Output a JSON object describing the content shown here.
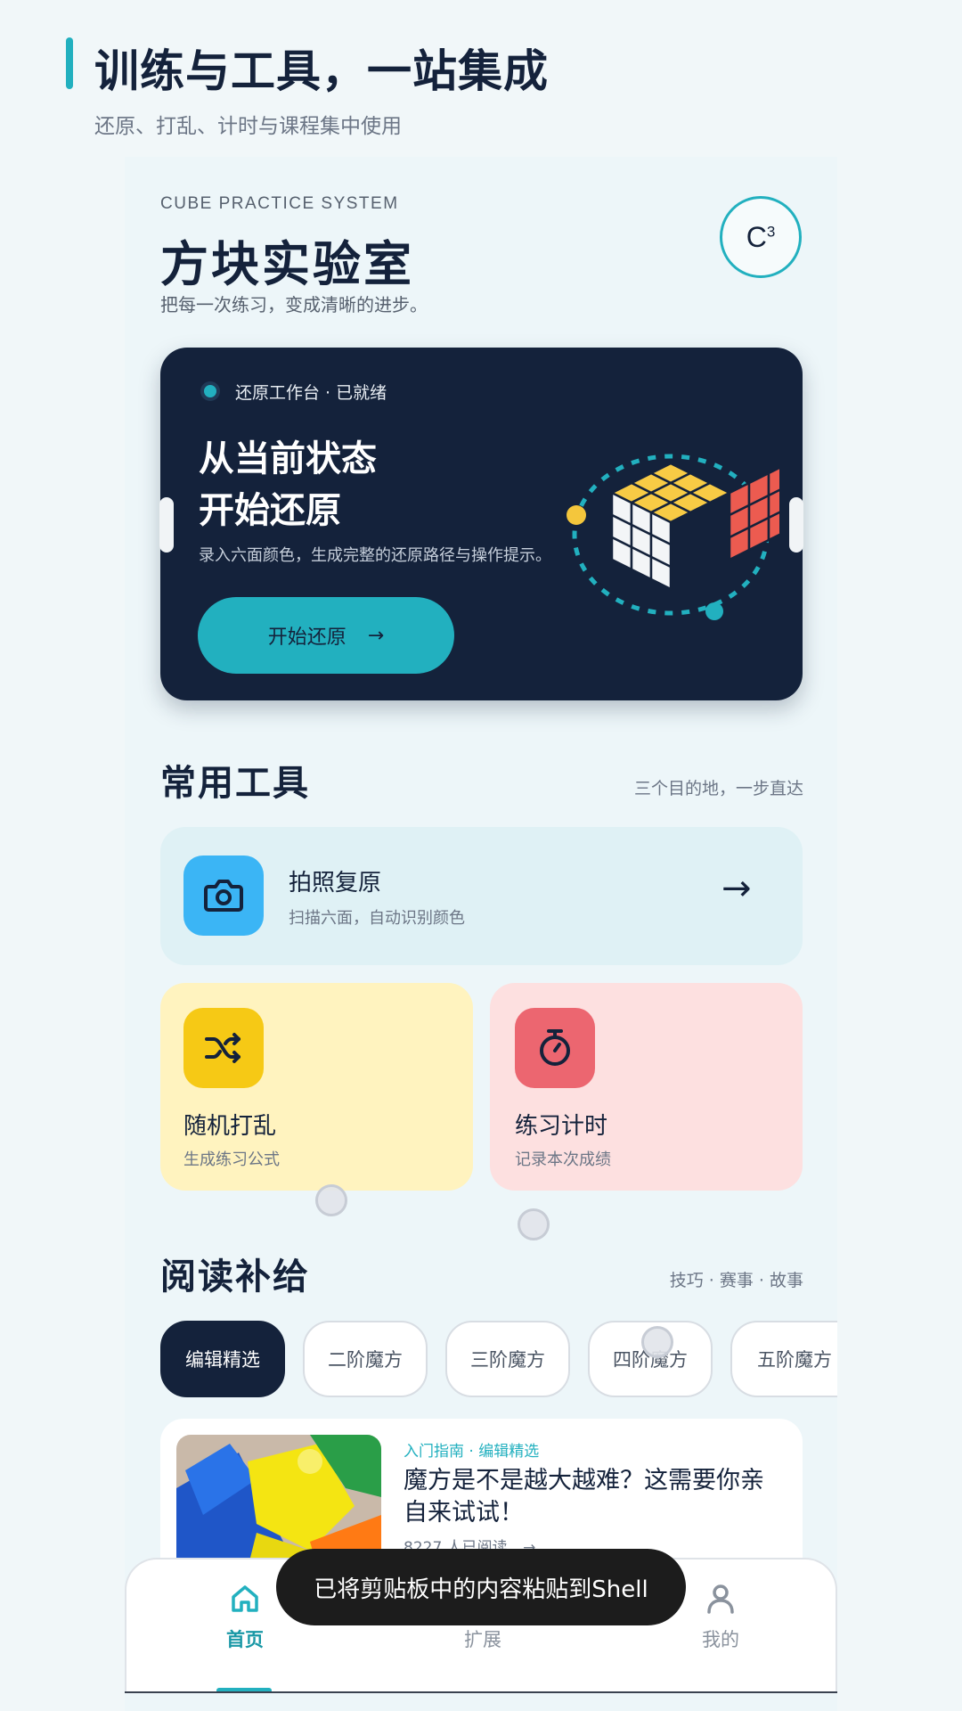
{
  "header": {
    "title": "训练与工具，一站集成",
    "subtitle": "还原、打乱、计时与课程集中使用"
  },
  "brand": {
    "en": "CUBE PRACTICE SYSTEM",
    "title": "方块实验室",
    "slogan": "把每一次练习，变成清晰的进步。",
    "logo_text": "C",
    "logo_sup": "3"
  },
  "hero": {
    "status": "还原工作台 · 已就绪",
    "heading_line1": "从当前状态",
    "heading_line2": "开始还原",
    "description": "录入六面颜色，生成完整的还原路径与操作提示。",
    "button_label": "开始还原",
    "button_arrow": "→"
  },
  "tools": {
    "title": "常用工具",
    "meta": "三个目的地，一步直达",
    "items": [
      {
        "name": "拍照复原",
        "desc": "扫描六面，自动识别颜色",
        "icon": "camera-icon",
        "color": "#3bb5f5"
      },
      {
        "name": "随机打乱",
        "desc": "生成练习公式",
        "icon": "shuffle-icon",
        "color": "#f6c915"
      },
      {
        "name": "练习计时",
        "desc": "记录本次成绩",
        "icon": "stopwatch-icon",
        "color": "#ec6670"
      }
    ],
    "arrow": "→"
  },
  "reading": {
    "title": "阅读补给",
    "meta": "技巧 · 赛事 · 故事",
    "chips": [
      "编辑精选",
      "二阶魔方",
      "三阶魔方",
      "四阶魔方",
      "五阶魔方"
    ],
    "active_chip": 0,
    "article": {
      "tag": "入门指南 · 编辑精选",
      "title": "魔方是不是越大越难？这需要你亲自来试试！",
      "reads": "8227 人已阅读",
      "arrow": "→"
    }
  },
  "nav": {
    "items": [
      {
        "label": "首页",
        "icon": "home-icon",
        "active": true
      },
      {
        "label": "扩展",
        "icon": "extension-icon",
        "active": false
      },
      {
        "label": "我的",
        "icon": "profile-icon",
        "active": false
      }
    ]
  },
  "toast": "已将剪贴板中的内容粘贴到Shell",
  "colors": {
    "accent": "#22b0bf",
    "navy": "#14223b",
    "camera_bg": "#3bb5f5",
    "shuffle_card": "#fff3bf",
    "shuffle_icon": "#f6c915",
    "timer_card": "#fde0e0",
    "timer_icon": "#ec6670"
  }
}
